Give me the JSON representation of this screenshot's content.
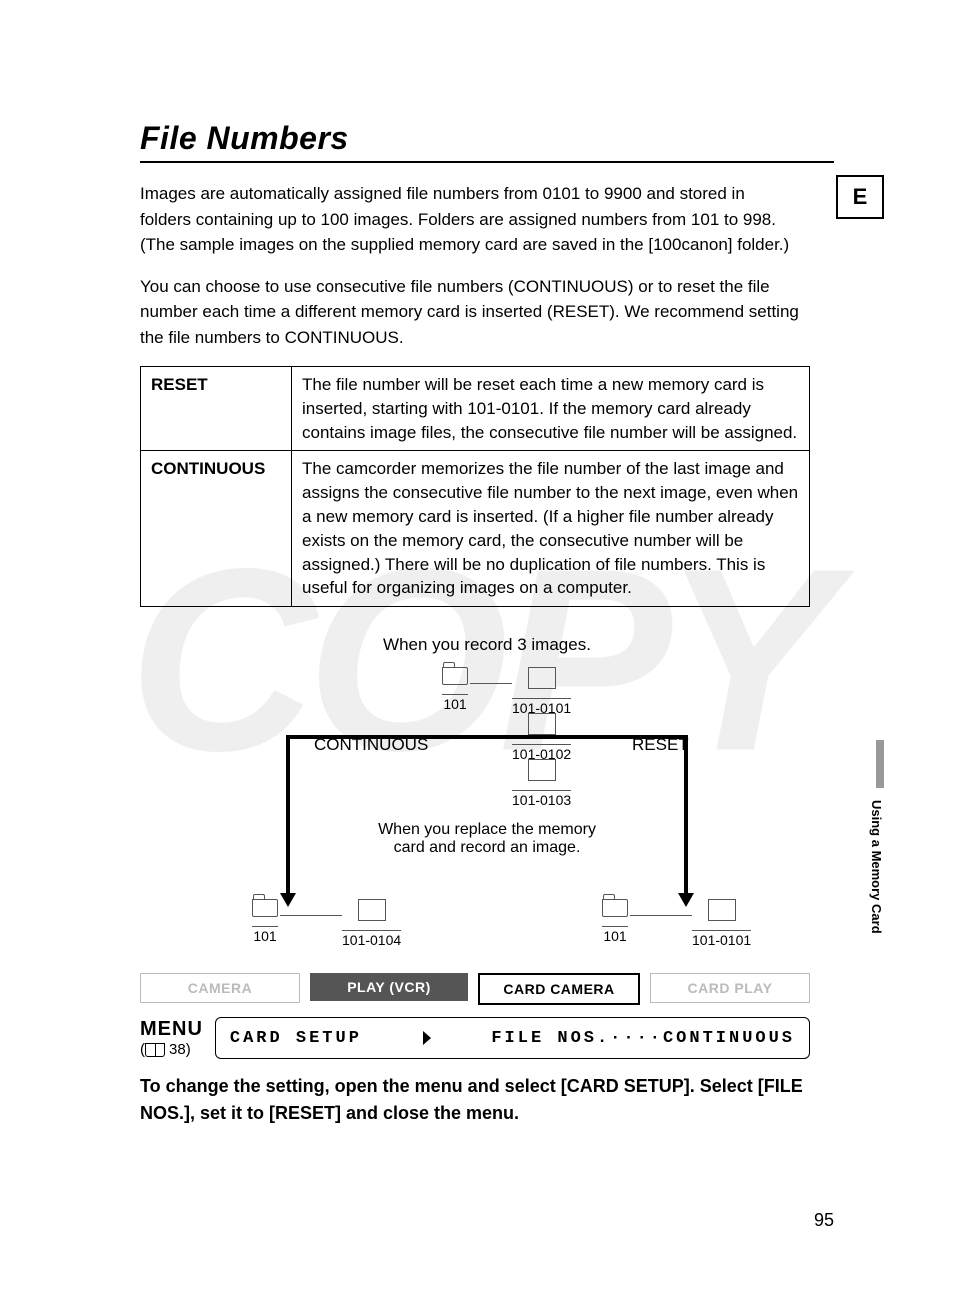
{
  "title": "File Numbers",
  "tab_letter": "E",
  "side_section": "Using a Memory Card",
  "para1": "Images are automatically assigned file numbers from 0101 to 9900 and stored in folders containing up to 100 images. Folders are assigned numbers from 101 to 998. (The sample images on the supplied memory card are saved in the [100canon] folder.)",
  "para2": "You can choose to use consecutive file numbers (CONTINUOUS) or to reset the file number each time a different memory card is inserted (RESET). We recommend setting the file numbers to CONTINUOUS.",
  "table": {
    "rows": [
      {
        "key": "RESET",
        "val": "The file number will be reset each time a new memory card is inserted, starting with 101-0101. If the memory card already contains image files, the consecutive file number will be assigned."
      },
      {
        "key": "CONTINUOUS",
        "val": "The camcorder memorizes the file number of the last image and assigns the consecutive file number to the next image, even when a new memory card is inserted. (If a higher file number already exists on the memory card, the consecutive number will be assigned.) There will be no duplication of file numbers. This is useful for organizing images on a computer."
      }
    ]
  },
  "diagram": {
    "caption_top": "When you record 3 images.",
    "caption_mid_1": "When you replace the memory",
    "caption_mid_2": "card and record an image.",
    "branch_left": "CONTINUOUS",
    "branch_right": "RESET",
    "folder_top": "101",
    "img1": "101-0101",
    "img2": "101-0102",
    "img3": "101-0103",
    "left_folder": "101",
    "left_img": "101-0104",
    "right_folder": "101",
    "right_img": "101-0101"
  },
  "modes": {
    "camera": "CAMERA",
    "play": "PLAY (VCR)",
    "cardcam": "CARD CAMERA",
    "cardplay": "CARD PLAY"
  },
  "menu": {
    "label": "MENU",
    "page": "38",
    "left": "CARD SETUP",
    "right": "FILE NOS.····CONTINUOUS"
  },
  "instruction": "To change the setting, open the menu and select [CARD SETUP]. Select [FILE NOS.], set it to [RESET] and close the menu.",
  "page_number": "95"
}
